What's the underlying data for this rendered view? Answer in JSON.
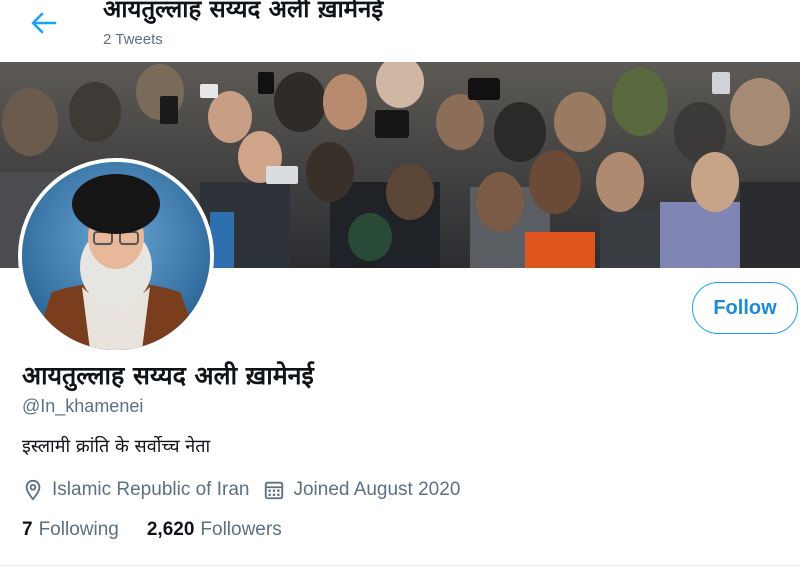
{
  "header": {
    "title": "आयतुल्लाह सय्यद अली ख़ामेनई",
    "tweet_count": "2 Tweets"
  },
  "profile": {
    "display_name": "आयतुल्लाह सय्यद अली ख़ामेनई",
    "handle": "@In_khamenei",
    "bio": "इस्लामी क्रांति के सर्वोच्च नेता",
    "location": "Islamic Republic of Iran",
    "joined": "Joined August 2020"
  },
  "actions": {
    "follow_label": "Follow"
  },
  "stats": {
    "following_count": "7",
    "following_label": "Following",
    "followers_count": "2,620",
    "followers_label": "Followers"
  },
  "colors": {
    "accent": "#1da1f2",
    "secondary_text": "#5b7083",
    "primary_text": "#0f1419"
  },
  "icons": {
    "back": "arrow-left-icon",
    "location": "location-pin-icon",
    "calendar": "calendar-icon"
  }
}
